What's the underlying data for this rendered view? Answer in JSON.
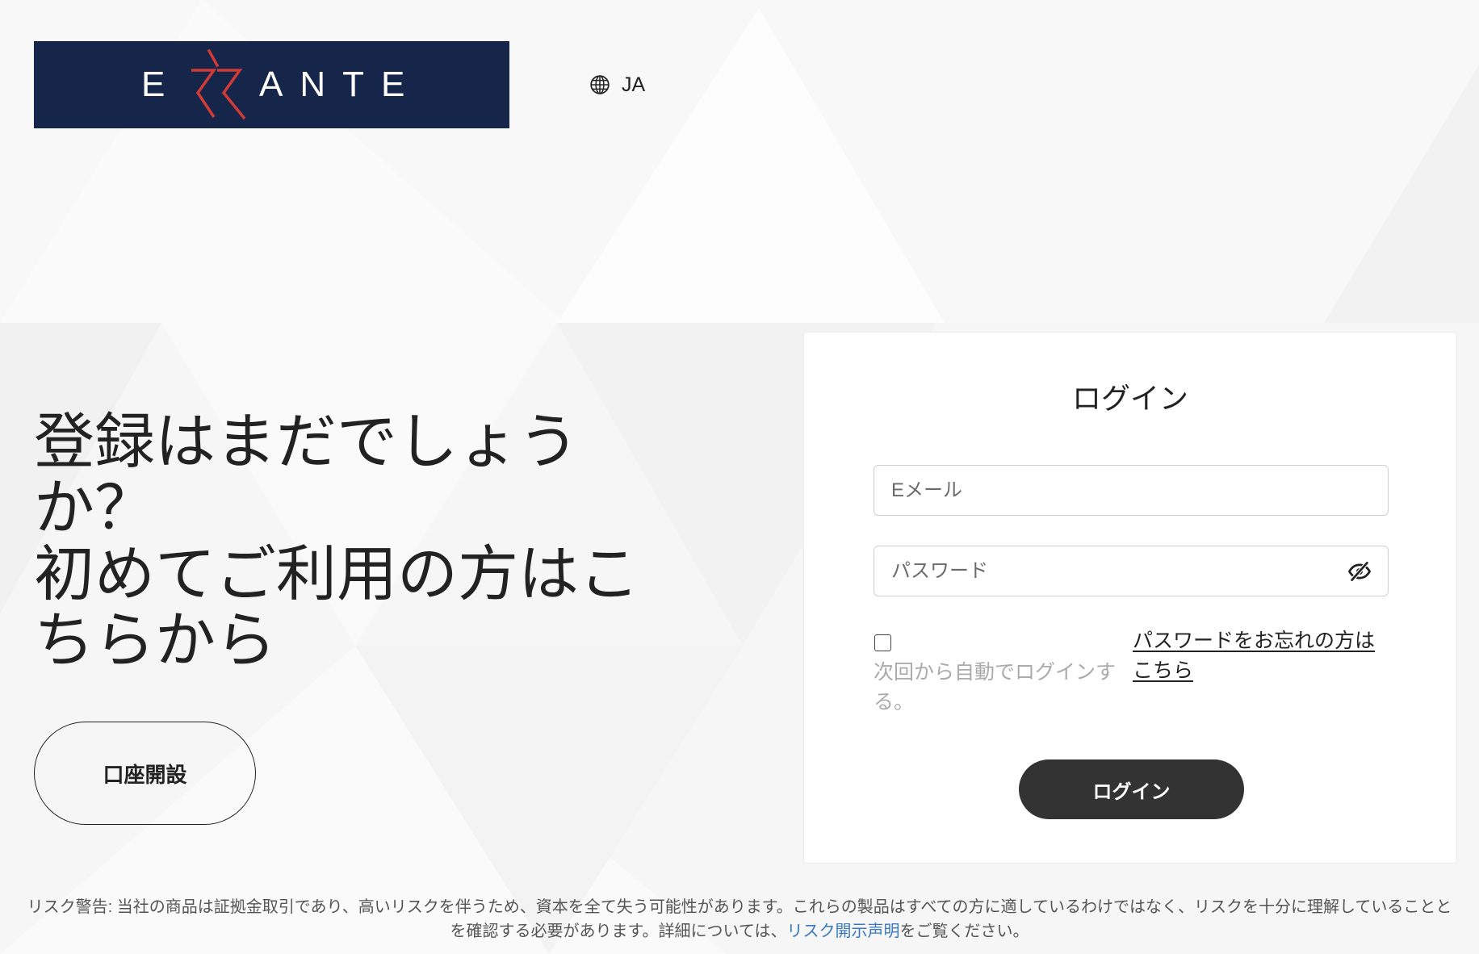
{
  "header": {
    "logo_text": "ERRANTE",
    "logo_left": "E",
    "logo_right": "ANTE",
    "language": "JA",
    "language_icon": "globe-icon"
  },
  "promo": {
    "heading_line1": "登録はまだでしょうか？",
    "heading_line2": "初めてご利用の方はこちらから",
    "open_account_label": "口座開設"
  },
  "login": {
    "title": "ログイン",
    "email_placeholder": "Eメール",
    "password_placeholder": "パスワード",
    "password_toggle_icon": "eye-slash-icon",
    "remember_checked": false,
    "remember_label": "次回から自動でログインする。",
    "forgot_link": "パスワードをお忘れの方はこちら",
    "submit_label": "ログイン"
  },
  "footer": {
    "risk_line1": "リスク警告: 当社の商品は証拠金取引であり、高いリスクを伴うため、資本を全て失う可能性があります。これらの製品はすべての方に適しているわけではなく、リスクを十分に理解していることと",
    "risk_line2_prefix": "を確認する必要があります。詳細については、",
    "risk_link": "リスク開示声明",
    "risk_line2_suffix": "をご覧ください。"
  },
  "colors": {
    "brand_navy": "#16264a",
    "brand_red": "#d23a35",
    "button_dark": "#333333",
    "link_blue": "#3b78c2",
    "muted_text": "#ababab"
  }
}
